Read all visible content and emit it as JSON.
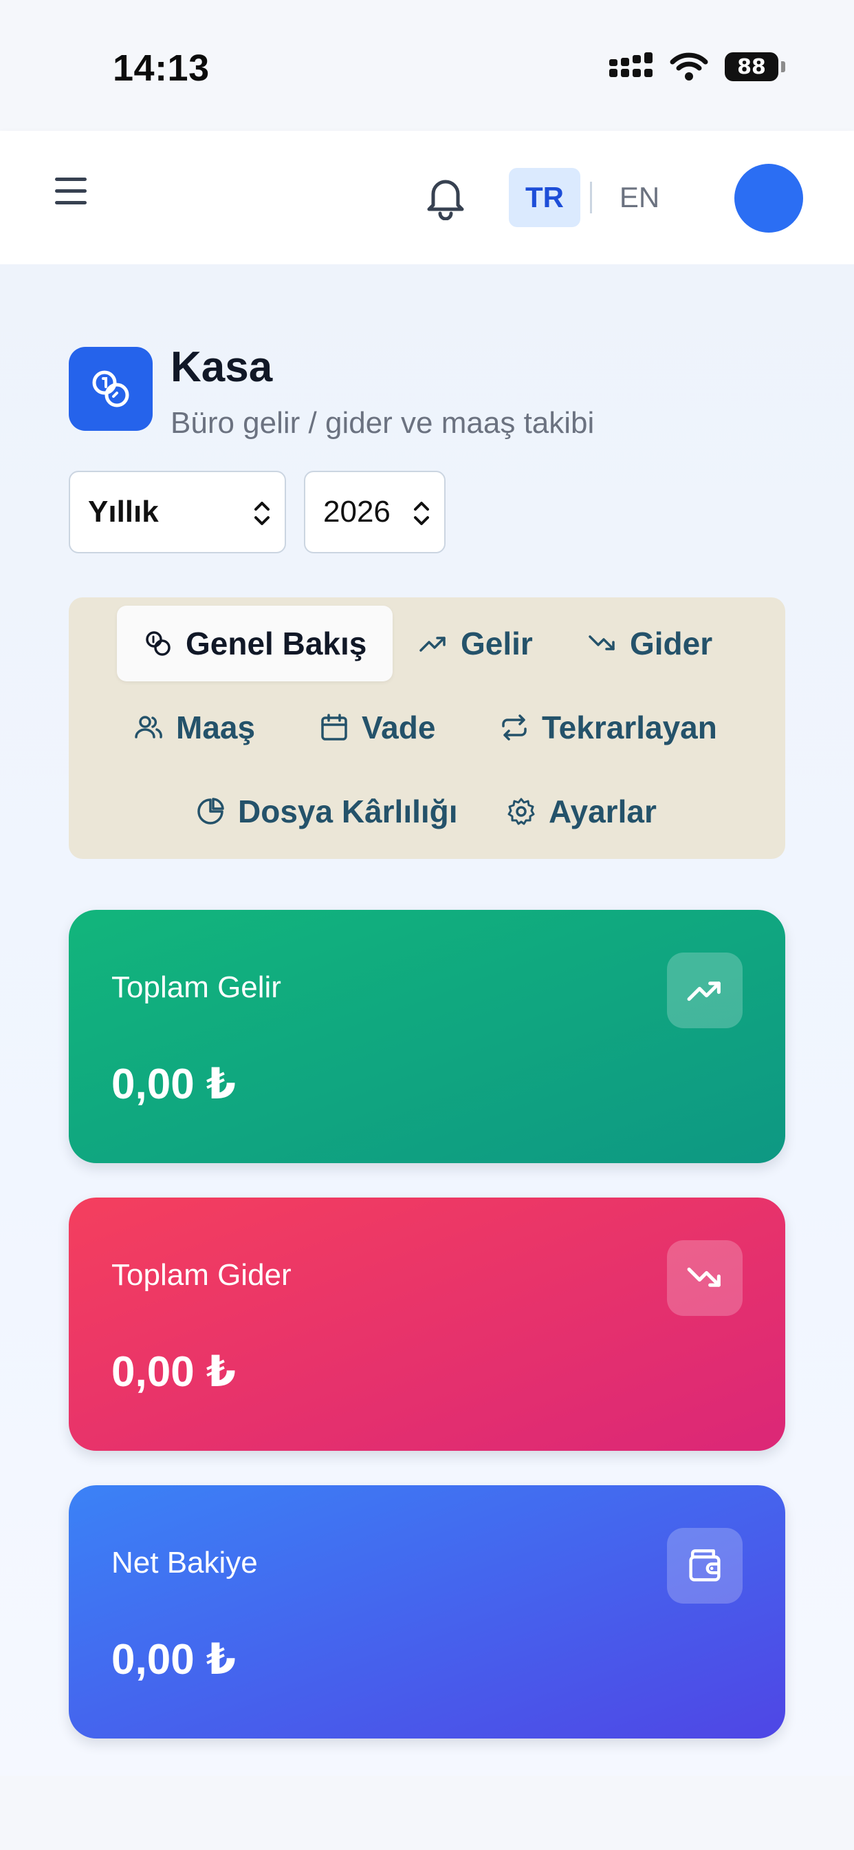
{
  "status_bar": {
    "time": "14:13",
    "battery": "88"
  },
  "header": {
    "lang_tr": "TR",
    "lang_en": "EN"
  },
  "page": {
    "title": "Kasa",
    "subtitle": "Büro gelir / gider ve maaş takibi"
  },
  "filters": {
    "period": "Yıllık",
    "year": "2026"
  },
  "tabs": [
    {
      "label": "Genel Bakış",
      "icon": "coins-icon",
      "active": true
    },
    {
      "label": "Gelir",
      "icon": "trending-up-icon"
    },
    {
      "label": "Gider",
      "icon": "trending-down-icon"
    },
    {
      "label": "Maaş",
      "icon": "users-icon"
    },
    {
      "label": "Vade",
      "icon": "calendar-icon"
    },
    {
      "label": "Tekrarlayan",
      "icon": "repeat-icon"
    },
    {
      "label": "Dosya Kârlılığı",
      "icon": "pie-chart-icon"
    },
    {
      "label": "Ayarlar",
      "icon": "gear-icon"
    }
  ],
  "stats": [
    {
      "label": "Toplam Gelir",
      "value": "0,00 ₺",
      "icon": "trending-up-icon",
      "color": "#12b57c"
    },
    {
      "label": "Toplam Gider",
      "value": "0,00 ₺",
      "icon": "trending-down-icon",
      "color": "#f43f5e"
    },
    {
      "label": "Net Bakiye",
      "value": "0,00 ₺",
      "icon": "wallet-icon",
      "color": "#3b82f6"
    }
  ],
  "colors": {
    "accent": "#2563eb",
    "tab_bg": "#ebe6d7"
  }
}
